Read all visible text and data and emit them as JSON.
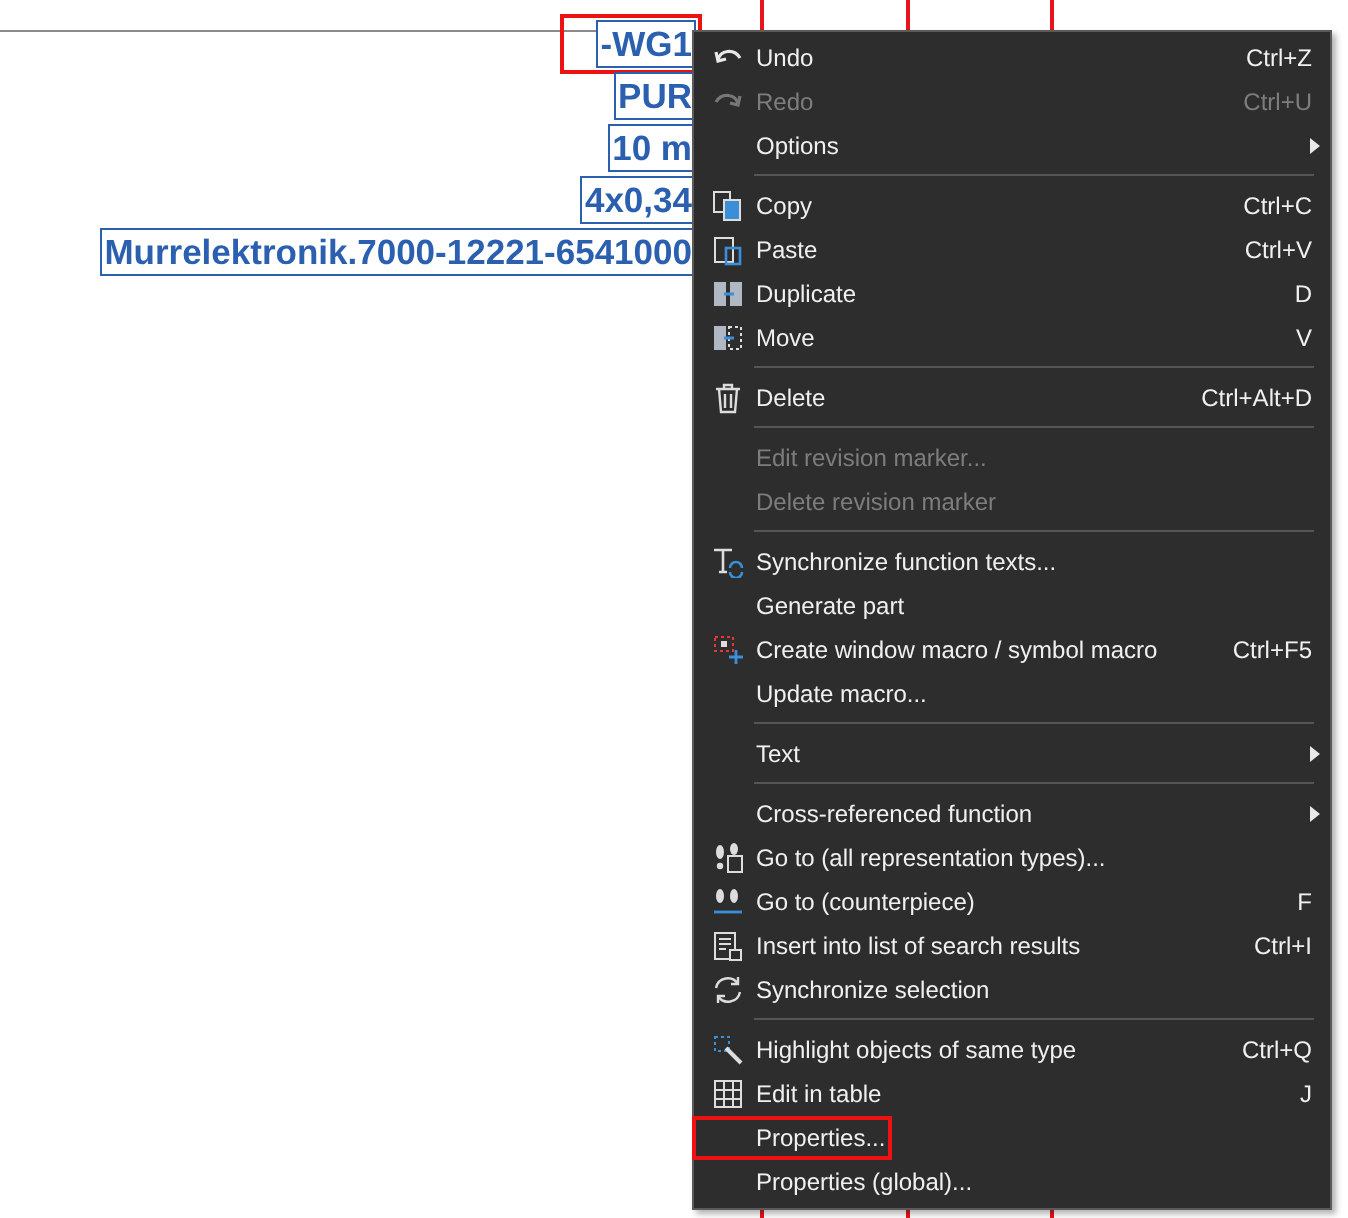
{
  "labels": [
    {
      "text": "-WG1",
      "highlighted": true
    },
    {
      "text": "PUR",
      "highlighted": false
    },
    {
      "text": "10 m",
      "highlighted": false
    },
    {
      "text": "4x0,34",
      "highlighted": false
    },
    {
      "text": "Murrelektronik.7000-12221-6541000",
      "highlighted": false
    }
  ],
  "menu": {
    "items": [
      {
        "kind": "command",
        "label": "Undo",
        "shortcut": "Ctrl+Z",
        "disabled": false,
        "highlighted": false
      },
      {
        "kind": "command",
        "label": "Redo",
        "shortcut": "Ctrl+U",
        "disabled": true,
        "highlighted": false
      },
      {
        "kind": "submenu",
        "label": "Options",
        "disabled": false,
        "highlighted": false
      },
      {
        "kind": "separator"
      },
      {
        "kind": "command",
        "label": "Copy",
        "shortcut": "Ctrl+C",
        "disabled": false,
        "highlighted": false
      },
      {
        "kind": "command",
        "label": "Paste",
        "shortcut": "Ctrl+V",
        "disabled": false,
        "highlighted": false
      },
      {
        "kind": "command",
        "label": "Duplicate",
        "shortcut": "D",
        "disabled": false,
        "highlighted": false
      },
      {
        "kind": "command",
        "label": "Move",
        "shortcut": "V",
        "disabled": false,
        "highlighted": false
      },
      {
        "kind": "separator"
      },
      {
        "kind": "command",
        "label": "Delete",
        "shortcut": "Ctrl+Alt+D",
        "disabled": false,
        "highlighted": false
      },
      {
        "kind": "separator"
      },
      {
        "kind": "command",
        "label": "Edit revision marker...",
        "disabled": true,
        "highlighted": false
      },
      {
        "kind": "command",
        "label": "Delete revision marker",
        "disabled": true,
        "highlighted": false
      },
      {
        "kind": "separator"
      },
      {
        "kind": "command",
        "label": "Synchronize function texts...",
        "disabled": false,
        "highlighted": false
      },
      {
        "kind": "command",
        "label": "Generate part",
        "disabled": false,
        "highlighted": false
      },
      {
        "kind": "command",
        "label": "Create window macro / symbol macro",
        "shortcut": "Ctrl+F5",
        "disabled": false,
        "highlighted": false
      },
      {
        "kind": "command",
        "label": "Update macro...",
        "disabled": false,
        "highlighted": false
      },
      {
        "kind": "separator"
      },
      {
        "kind": "submenu",
        "label": "Text",
        "disabled": false,
        "highlighted": false
      },
      {
        "kind": "separator"
      },
      {
        "kind": "submenu",
        "label": "Cross-referenced function",
        "disabled": false,
        "highlighted": false
      },
      {
        "kind": "command",
        "label": "Go to (all representation types)...",
        "disabled": false,
        "highlighted": false
      },
      {
        "kind": "command",
        "label": "Go to (counterpiece)",
        "shortcut": "F",
        "disabled": false,
        "highlighted": false
      },
      {
        "kind": "command",
        "label": "Insert into list of search results",
        "shortcut": "Ctrl+I",
        "disabled": false,
        "highlighted": false
      },
      {
        "kind": "command",
        "label": "Synchronize selection",
        "disabled": false,
        "highlighted": false
      },
      {
        "kind": "separator"
      },
      {
        "kind": "command",
        "label": "Highlight objects of same type",
        "shortcut": "Ctrl+Q",
        "disabled": false,
        "highlighted": false
      },
      {
        "kind": "command",
        "label": "Edit in table",
        "shortcut": "J",
        "disabled": false,
        "highlighted": false
      },
      {
        "kind": "command",
        "label": "Properties...",
        "disabled": false,
        "highlighted": true
      },
      {
        "kind": "command",
        "label": "Properties (global)...",
        "disabled": false,
        "highlighted": false
      }
    ]
  }
}
